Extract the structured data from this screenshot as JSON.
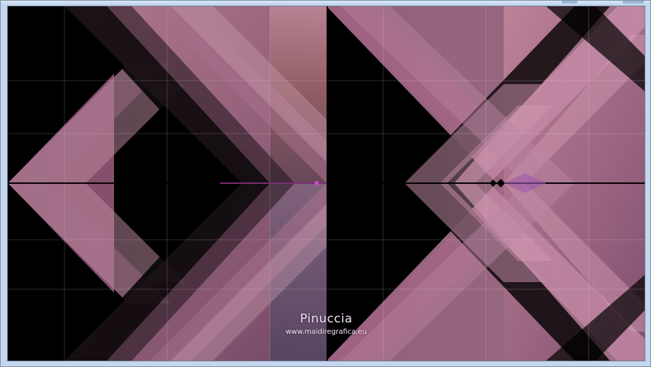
{
  "window": {
    "frame_color": "#c4d7ee",
    "accent_color": "#b06aa0"
  },
  "image": {
    "watermark_name": "Pinuccia",
    "watermark_url": "www.maidiregrafica.eu",
    "palette": [
      "#000000",
      "#b86e96",
      "#c98fab",
      "#8a4f73",
      "#6f4a62",
      "#d9a0b8",
      "#e04fd8"
    ]
  }
}
